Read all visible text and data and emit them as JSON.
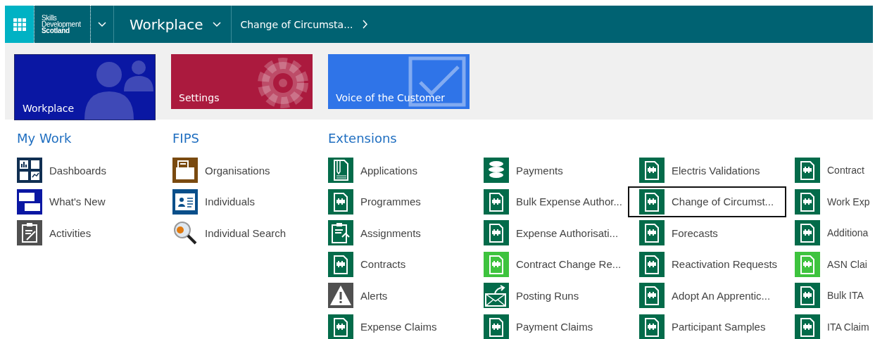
{
  "nav": {
    "logo": [
      "Skills",
      "Development",
      "Scotland"
    ],
    "area": "Workplace",
    "breadcrumb": "Change of Circumsta..."
  },
  "tiles": [
    {
      "label": "Workplace",
      "kind": "people",
      "color": "#0a17a3",
      "selected": true
    },
    {
      "label": "Settings",
      "kind": "gear",
      "color": "#ab1a3e",
      "selected": false
    },
    {
      "label": "Voice of the Customer",
      "kind": "check",
      "color": "#2f74e8",
      "selected": false
    }
  ],
  "sections": [
    {
      "title": "My Work",
      "columns": [
        {
          "items": [
            {
              "label": "Dashboards",
              "kind": "dashboards",
              "color": "#102f52",
              "selected": false
            },
            {
              "label": "What's New",
              "kind": "chat",
              "color": "#0a17a3",
              "selected": false
            },
            {
              "label": "Activities",
              "kind": "clipboard",
              "color": "#505050",
              "selected": false
            }
          ]
        }
      ]
    },
    {
      "title": "FIPS",
      "columns": [
        {
          "items": [
            {
              "label": "Organisations",
              "kind": "folder",
              "color": "#7a4a10",
              "selected": false
            },
            {
              "label": "Individuals",
              "kind": "card",
              "color": "#0a4f8a",
              "selected": false
            },
            {
              "label": "Individual Search",
              "kind": "search",
              "color": "#e07a10",
              "selected": false
            }
          ]
        }
      ]
    },
    {
      "title": "Extensions",
      "columns": [
        {
          "items": [
            {
              "label": "Applications",
              "kind": "document",
              "color": "#036b4a",
              "selected": false
            },
            {
              "label": "Programmes",
              "kind": "entity",
              "color": "#036b4a",
              "selected": false
            },
            {
              "label": "Assignments",
              "kind": "assign",
              "color": "#036b4a",
              "selected": false
            },
            {
              "label": "Contracts",
              "kind": "entity",
              "color": "#036b4a",
              "selected": false
            },
            {
              "label": "Alerts",
              "kind": "alert",
              "color": "#505050",
              "selected": false
            },
            {
              "label": "Expense Claims",
              "kind": "entity",
              "color": "#036b4a",
              "selected": false
            }
          ]
        },
        {
          "items": [
            {
              "label": "Payments",
              "kind": "coins",
              "color": "#036b4a",
              "selected": false
            },
            {
              "label": "Bulk Expense Author...",
              "kind": "entity",
              "color": "#036b4a",
              "selected": false
            },
            {
              "label": "Expense Authorisati...",
              "kind": "entity",
              "color": "#036b4a",
              "selected": false
            },
            {
              "label": "Contract Change Re...",
              "kind": "entity",
              "color": "#3ec33e",
              "selected": false
            },
            {
              "label": "Posting Runs",
              "kind": "mail",
              "color": "#036b4a",
              "selected": false
            },
            {
              "label": "Payment Claims",
              "kind": "entity",
              "color": "#036b4a",
              "selected": false
            }
          ]
        },
        {
          "items": [
            {
              "label": "Electris Validations",
              "kind": "entity",
              "color": "#036b4a",
              "selected": false
            },
            {
              "label": "Change of Circumst...",
              "kind": "entity",
              "color": "#036b4a",
              "selected": true
            },
            {
              "label": "Forecasts",
              "kind": "entity",
              "color": "#036b4a",
              "selected": false
            },
            {
              "label": "Reactivation Requests",
              "kind": "entity",
              "color": "#036b4a",
              "selected": false
            },
            {
              "label": "Adopt An Apprentic...",
              "kind": "entity",
              "color": "#036b4a",
              "selected": false
            },
            {
              "label": "Participant Samples",
              "kind": "entity",
              "color": "#036b4a",
              "selected": false
            }
          ]
        },
        {
          "items": [
            {
              "label": "Contract",
              "kind": "entity",
              "color": "#036b4a",
              "selected": false
            },
            {
              "label": "Work Exp",
              "kind": "entity",
              "color": "#036b4a",
              "selected": false
            },
            {
              "label": "Additiona",
              "kind": "entity",
              "color": "#036b4a",
              "selected": false
            },
            {
              "label": "ASN Clai",
              "kind": "entity",
              "color": "#3ec33e",
              "selected": false
            },
            {
              "label": "Bulk ITA",
              "kind": "entity",
              "color": "#036b4a",
              "selected": false
            },
            {
              "label": "ITA Claim",
              "kind": "entity",
              "color": "#036b4a",
              "selected": false
            }
          ]
        }
      ]
    }
  ]
}
